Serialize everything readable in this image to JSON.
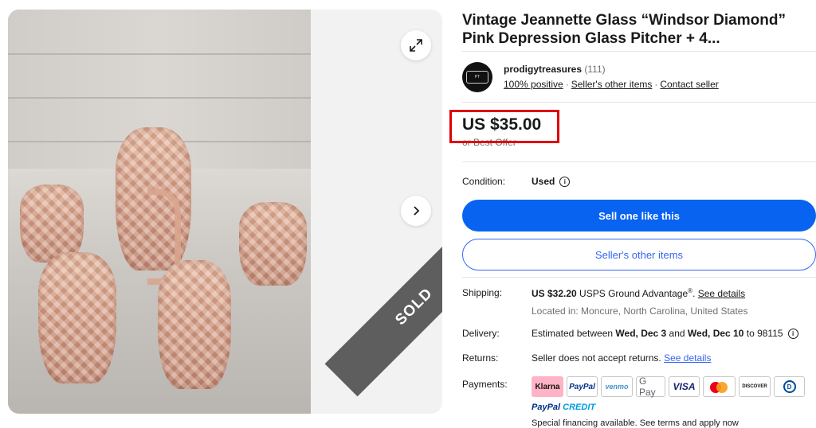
{
  "gallery": {
    "sold_label": "SOLD",
    "expand_icon": "expand-icon",
    "next_icon": "chevron-right-icon"
  },
  "listing": {
    "title": "Vintage Jeannette Glass “Windsor Diamond” Pink Depression Glass Pitcher + 4..."
  },
  "seller": {
    "name": "prodigytreasures",
    "count": "(111)",
    "positive": "100% positive",
    "other_items": "Seller's other items",
    "contact": "Contact seller"
  },
  "price": {
    "amount": "US $35.00",
    "best_offer": "or Best Offer"
  },
  "condition": {
    "label": "Condition:",
    "value": "Used"
  },
  "buttons": {
    "sell_one": "Sell one like this",
    "seller_items": "Seller's other items"
  },
  "shipping": {
    "label": "Shipping:",
    "amount": "US $32.20",
    "service": " USPS Ground Advantage",
    "reg": "®",
    "details_link": "See details",
    "location": "Located in: Moncure, North Carolina, United States"
  },
  "delivery": {
    "label": "Delivery:",
    "prefix": "Estimated between ",
    "start": "Wed, Dec 3",
    "mid": " and ",
    "end": "Wed, Dec 10",
    "suffix": " to 98115"
  },
  "returns": {
    "label": "Returns:",
    "text": "Seller does not accept returns. ",
    "link": "See details"
  },
  "payments": {
    "label": "Payments:",
    "methods": [
      "Klarna",
      "PayPal",
      "venmo",
      "G Pay",
      "VISA",
      "Mastercard",
      "DISCOVER",
      "Diners Club"
    ],
    "paypal_credit_a": "PayPal",
    "paypal_credit_b": " CREDIT",
    "financing": "Special financing available. See terms and apply now"
  },
  "colors": {
    "primary_blue": "#0863f1",
    "link_blue": "#3665f3",
    "highlight_red": "#e00000",
    "sold_band": "#5e5e5e"
  }
}
